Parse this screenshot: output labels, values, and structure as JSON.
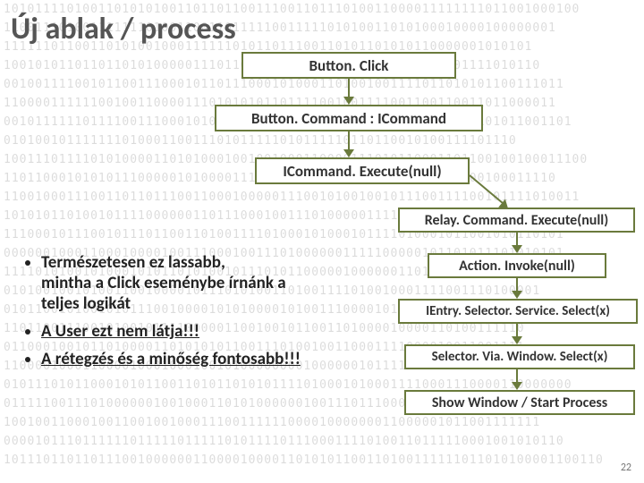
{
  "title": "Új ablak / process",
  "flow_left": {
    "b1": "Button. Click",
    "b2": "Button. Command : ICommand",
    "b3": "ICommand. Execute(null)"
  },
  "flow_right": {
    "r1": "Relay. Command. Execute(null)",
    "r2": "Action. Invoke(null)",
    "r3": "IEntry. Selector. Service. Select(x)",
    "r4": "Selector. Via. Window. Select(x)",
    "r5": "Show Window / Start Process"
  },
  "bullets": {
    "b1_l1": "Természetesen ez lassabb,",
    "b1_l2": "mintha a Click eseménybe írnánk a",
    "b1_l3": "teljes logikát",
    "b2": "A User ezt nem látja!!!",
    "b3": "A rétegzés és a minőség fontosabb!!!"
  },
  "slide_number": "22",
  "binary_bg": "1010111101001101010100110110110011100110111010011000011111111011001000100\n1100111010011111110100110011011111001111101010011010100010000100000001\n1111110110011010100100011111101011011100110101101010110000001010101\n10010101101101101010000011101100101011001100101010111001001111010110\n00100111100101100111000101101110001010001101001001111011010101100111011\n1100001111110010011000011101010101101111001001111001100110011011000011\n001011111101111001110001010111110100111110111001011110100101101011001101\n01010010111111101000110011101011111010111110110110010100111101110\n10011101111010100001101010001001001000110000111010110001101100100100011100\n1101100010101011100000101000011101110010111011000101110101100100011110\n1100100011100110110111001100010000011100101001001011100111100101111010011\n101010110100101111000000110111000100111010000011110100000011101010\n11100010111001011101100110100111101000101000101111010001011001010110101\n00000010001100010000100111000100111010000001111100000101101011101010101\n111101010010100010101101010010111010110000010000001101101100011100011\n01010010010100110010000101110101001101001111010010001111001110100001\n01011001010010101110010000101010000101001110000101011010111110001011101\n110110011100101001011110000011001001011001101000010000110100111110\n011000100101101000011010101011001110100100110001111000010011001111\n11000010001100001000100010010100000000100000010111100101101100011001011\n010111010110001010110011010110101011110100010100011110001110000110000000\n0111110011101000000100100011010100000010011101110000000101001001000010101\n10010011000100110010010001110011111100001000000011000001011001111111\n00001011101111110111110111110101111011100011110100110111110001001010110\n1011101101101110010000001100001000011010101100110100111111011010100001100110"
}
